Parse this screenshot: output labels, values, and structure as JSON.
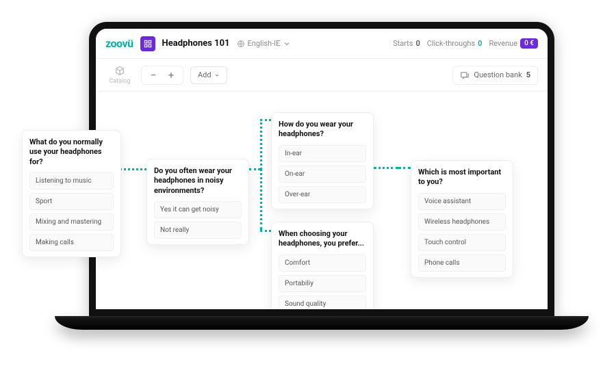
{
  "header": {
    "logo_text": "zoovü",
    "project_title": "Headphones 101",
    "language_label": "English-IE",
    "stats": {
      "starts_label": "Starts",
      "starts_value": "0",
      "clicks_label": "Click-throughs",
      "clicks_value": "0",
      "revenue_label": "Revenue",
      "revenue_value": "0 €"
    }
  },
  "sidebar": {
    "catalog_label": "Catalog"
  },
  "toolbar": {
    "add_label": "Add",
    "question_bank_label": "Question bank",
    "question_bank_count": "5"
  },
  "flow": {
    "card1": {
      "question": "What do you normally use your headphones for?",
      "opts": {
        "0": "Listening to music",
        "1": "Sport",
        "2": "Mixing and mastering",
        "3": "Making calls"
      }
    },
    "card2": {
      "question": "Do you often wear your headphones in noisy environments?",
      "opts": {
        "0": "Yes it can get noisy",
        "1": "Not really"
      }
    },
    "card3": {
      "question": "How do you wear your headphones?",
      "opts": {
        "0": "In-ear",
        "1": "On-ear",
        "2": "Over-ear"
      }
    },
    "card4": {
      "question": "When choosing your headphones, you prefer...",
      "opts": {
        "0": "Comfort",
        "1": "Portabiliy",
        "2": "Sound quality"
      }
    },
    "card5": {
      "question": "Which is most important to you?",
      "opts": {
        "0": "Voice assistant",
        "1": "Wireless headphones",
        "2": "Touch control",
        "3": "Phone calls"
      }
    }
  }
}
